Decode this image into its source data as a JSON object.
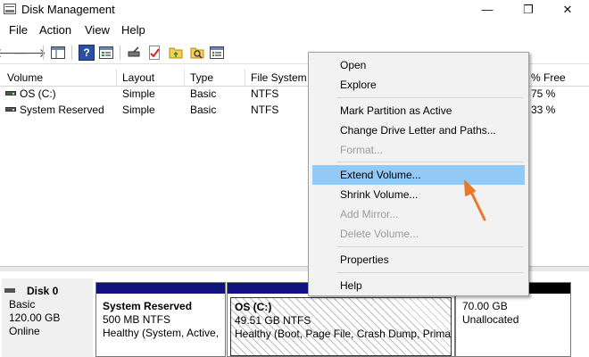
{
  "window": {
    "title": "Disk Management",
    "min": "—",
    "max": "❐",
    "close": "✕"
  },
  "menubar": [
    {
      "label": "File"
    },
    {
      "label": "Action"
    },
    {
      "label": "View"
    },
    {
      "label": "Help"
    }
  ],
  "toolbar": {
    "back": "🡐",
    "forward": "🡒",
    "help": "?"
  },
  "volume_list": {
    "columns": [
      {
        "label": "Volume"
      },
      {
        "label": "Layout"
      },
      {
        "label": "Type"
      },
      {
        "label": "File System"
      },
      {
        "label": "% Free"
      }
    ],
    "rows": [
      {
        "volume": "OS (C:)",
        "layout": "Simple",
        "type": "Basic",
        "fs": "NTFS",
        "free": "75 %"
      },
      {
        "volume": "System Reserved",
        "layout": "Simple",
        "type": "Basic",
        "fs": "NTFS",
        "free": "33 %"
      }
    ]
  },
  "disk": {
    "name": "Disk 0",
    "type": "Basic",
    "size": "120.00 GB",
    "status": "Online",
    "partitions": [
      {
        "title": "System Reserved",
        "size": "500 MB NTFS",
        "status": "Healthy (System, Active,"
      },
      {
        "title": "OS  (C:)",
        "size": "49.51 GB NTFS",
        "status": "Healthy (Boot, Page File, Crash Dump, Primary"
      },
      {
        "title": "",
        "size": "70.00 GB",
        "status": "Unallocated"
      }
    ]
  },
  "context_menu": {
    "items": [
      {
        "label": "Open",
        "enabled": true
      },
      {
        "label": "Explore",
        "enabled": true
      },
      {
        "label": "Mark Partition as Active",
        "enabled": true
      },
      {
        "label": "Change Drive Letter and Paths...",
        "enabled": true
      },
      {
        "label": "Format...",
        "enabled": false
      },
      {
        "label": "Extend Volume...",
        "enabled": true,
        "highlighted": true
      },
      {
        "label": "Shrink Volume...",
        "enabled": true
      },
      {
        "label": "Add Mirror...",
        "enabled": false
      },
      {
        "label": "Delete Volume...",
        "enabled": false
      },
      {
        "label": "Properties",
        "enabled": true
      },
      {
        "label": "Help",
        "enabled": true
      }
    ]
  },
  "colors": {
    "highlight": "#91c9f7",
    "partition_bar": "#0f1280",
    "unallocated_bar": "#000000",
    "annotation_arrow": "#e8782a"
  }
}
